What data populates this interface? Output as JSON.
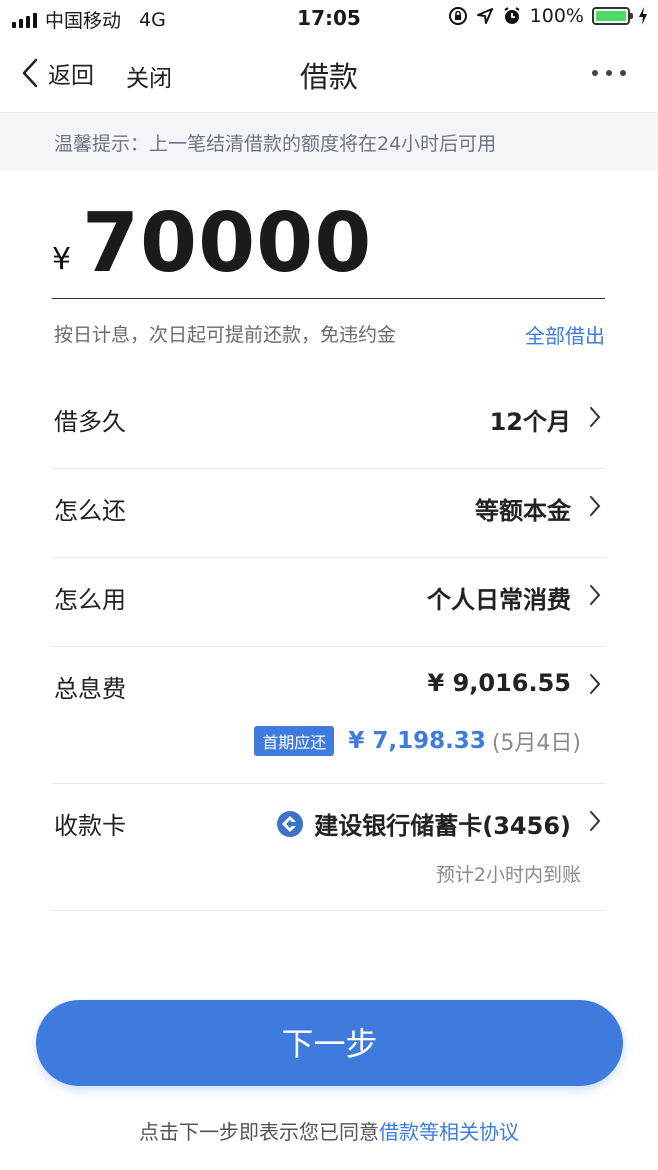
{
  "status_bar": {
    "carrier": "中国移动",
    "network": "4G",
    "time": "17:05",
    "battery": "100%",
    "battery_level": 1.0
  },
  "nav": {
    "back_label": "返回",
    "close_label": "关闭",
    "title": "借款"
  },
  "tip": "温馨提示：上一笔结清借款的额度将在24小时后可用",
  "amount": {
    "currency": "¥",
    "value": "70000"
  },
  "hint": "按日计息，次日起可提前还款，免违约金",
  "borrow_all": "全部借出",
  "rows": {
    "duration": {
      "label": "借多久",
      "value": "12个月"
    },
    "repay": {
      "label": "怎么还",
      "value": "等额本金"
    },
    "usage": {
      "label": "怎么用",
      "value": "个人日常消费"
    },
    "interest": {
      "label": "总息费",
      "value": "¥ 9,016.55",
      "badge": "首期应还",
      "first_amount": "¥ 7,198.33",
      "first_date": "(5月4日)"
    },
    "card": {
      "label": "收款卡",
      "value": "建设银行储蓄卡(3456)",
      "arrival": "预计2小时内到账"
    }
  },
  "next_button": "下一步",
  "agreement": {
    "prefix": "点击下一步即表示您已同意",
    "link": "借款等相关协议"
  },
  "colors": {
    "accent": "#3f7bdc",
    "tip_bg": "#f3f5f9",
    "battery": "#4cd964"
  },
  "icons": [
    "signal-icon",
    "lock-rotation-icon",
    "location-icon",
    "alarm-icon",
    "battery-icon",
    "charging-icon",
    "chevron-left-icon",
    "more-icon",
    "chevron-right-icon",
    "ccb-bank-icon"
  ]
}
